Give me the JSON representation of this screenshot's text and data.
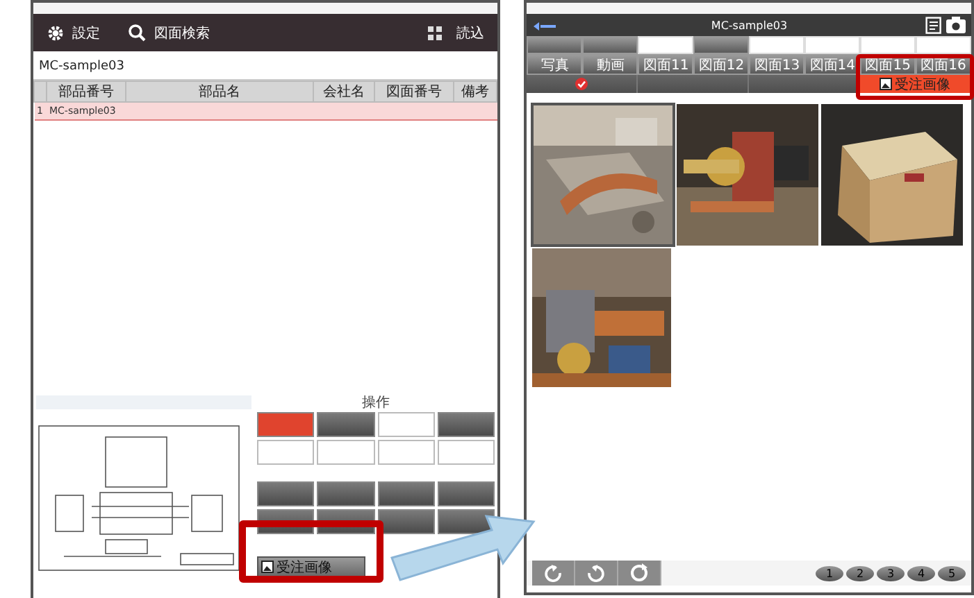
{
  "left_screen": {
    "header": {
      "settings_label": "設定",
      "search_label": "図面検索",
      "load_label": "読込"
    },
    "title": "MC-sample03",
    "table": {
      "columns": [
        "部品番号",
        "部品名",
        "会社名",
        "図面番号",
        "備考"
      ],
      "rows": [
        {
          "index": "1",
          "cells": [
            "MC-sample03"
          ],
          "selected": true
        }
      ]
    },
    "panel": {
      "heading": "操作",
      "buttons": [
        {
          "kind": "active"
        },
        {
          "kind": "dark"
        },
        {
          "kind": "light"
        },
        {
          "kind": "dark"
        },
        {
          "kind": "light"
        },
        {
          "kind": "light"
        },
        {
          "kind": "light"
        },
        {
          "kind": "light"
        },
        {
          "kind": "dark"
        },
        {
          "kind": "dark"
        },
        {
          "kind": "dark"
        },
        {
          "kind": "dark"
        },
        {
          "kind": "dark"
        },
        {
          "kind": "dark"
        },
        {
          "kind": "dark"
        },
        {
          "kind": "dark"
        }
      ],
      "order_image_button": "受注画像"
    }
  },
  "right_screen": {
    "title": "MC-sample03",
    "tab_rows": [
      [
        {
          "kind": "dark"
        },
        {
          "kind": "dark"
        },
        {
          "kind": "light"
        },
        {
          "kind": "dark"
        },
        {
          "kind": "light"
        },
        {
          "kind": "light"
        },
        {
          "kind": "light"
        },
        {
          "kind": "light"
        }
      ],
      [
        {
          "kind": "dark",
          "label": "写真"
        },
        {
          "kind": "dark",
          "label": "動画"
        },
        {
          "kind": "dark",
          "label": "図面11"
        },
        {
          "kind": "dark",
          "label": "図面12"
        },
        {
          "kind": "dark",
          "label": "図面13"
        },
        {
          "kind": "dark",
          "label": "図面14"
        },
        {
          "kind": "dark",
          "label": "図面15"
        },
        {
          "kind": "dark",
          "label": "図面16"
        }
      ]
    ],
    "filters": [
      {
        "checked": true,
        "selected": false
      },
      {
        "checked": false,
        "selected": false
      },
      {
        "checked": false,
        "selected": false
      },
      {
        "checked": false,
        "selected": true,
        "label": "受注画像"
      }
    ],
    "pages": [
      "1",
      "2",
      "3",
      "4",
      "5"
    ]
  }
}
